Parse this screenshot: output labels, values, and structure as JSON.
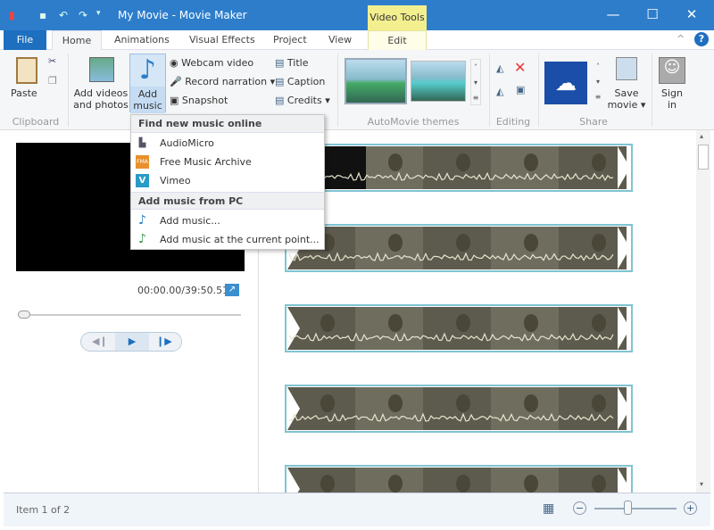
{
  "window": {
    "title": "My Movie - Movie Maker",
    "context_tab": "Video Tools",
    "minimize": "—",
    "maximize": "☐",
    "close": "✕"
  },
  "tabs": [
    {
      "label": "File"
    },
    {
      "label": "Home"
    },
    {
      "label": "Animations"
    },
    {
      "label": "Visual Effects"
    },
    {
      "label": "Project"
    },
    {
      "label": "View"
    },
    {
      "label": "Edit"
    }
  ],
  "ribbon": {
    "clipboard": {
      "label": "Clipboard",
      "paste": "Paste"
    },
    "add_videos": "Add videos and photos",
    "add_music": "Add music",
    "webcam": "Webcam video",
    "narration": "Record narration",
    "snapshot": "Snapshot",
    "title": "Title",
    "caption": "Caption",
    "credits": "Credits",
    "themes_label": "AutoMovie themes",
    "editing_label": "Editing",
    "share_label": "Share",
    "save_movie": "Save movie",
    "sign_in": "Sign in"
  },
  "menu": {
    "online_header": "Find new music online",
    "online": [
      {
        "label": "AudioMicro",
        "icon": "audiomicro-icon"
      },
      {
        "label": "Free Music Archive",
        "icon": "fma-icon"
      },
      {
        "label": "Vimeo",
        "icon": "vimeo-icon"
      }
    ],
    "pc_header": "Add music from PC",
    "pc": [
      {
        "label": "Add music..."
      },
      {
        "label": "Add music at the current point..."
      }
    ]
  },
  "preview": {
    "time": "00:00.00/39:50.51",
    "seek_fraction": 0
  },
  "status": {
    "text": "Item 1 of 2",
    "zoom_fraction": 0.4
  },
  "colors": {
    "titlebar": "#2d7dcb",
    "accent": "#1e6fc0",
    "context": "#f3ef8f",
    "strip_border": "#7fc4d2"
  }
}
